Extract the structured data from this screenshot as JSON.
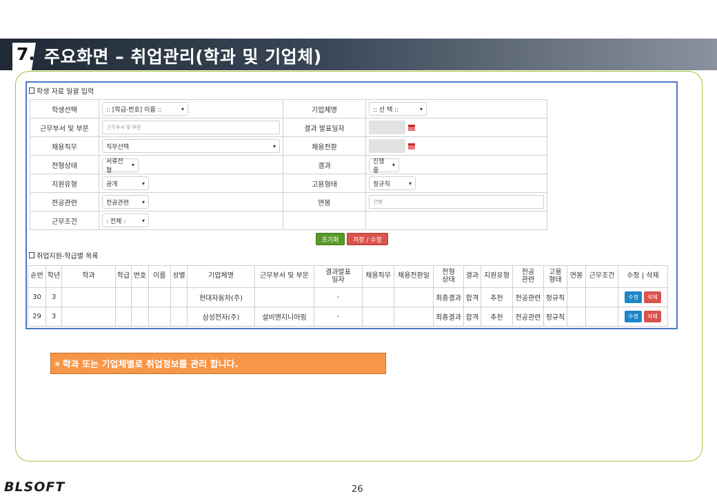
{
  "slide": {
    "number": "7.",
    "title": "주요화면 – 취업관리(학과 및 기업체)",
    "note": "학과 또는 기업체별로 취업정보를 관리 합니다.",
    "note_bullet": "■",
    "page": "26",
    "logo": "BLSOFT"
  },
  "form": {
    "section_title": "학생 자료 일괄 입력",
    "rows": [
      {
        "left_label": "학생선택",
        "left_value": ":: [학급-번호] 이름 ::",
        "right_label": "기업체명",
        "right_value": ":: 선 택 ::"
      },
      {
        "left_label": "근무부서 및 부문",
        "left_placeholder": "근무부서 및 부문",
        "right_label": "결과 발표일자"
      },
      {
        "left_label": "채용직무",
        "left_value": "직무선택",
        "right_label": "채용전환"
      },
      {
        "left_label": "전형상태",
        "left_value": "서류전형",
        "right_label": "결과",
        "right_value": "진행중"
      },
      {
        "left_label": "지원유형",
        "left_value": "공개",
        "right_label": "고용형태",
        "right_value": "정규직"
      },
      {
        "left_label": "전공관련",
        "left_value": "전공관련",
        "right_label": "연봉",
        "right_placeholder": "연봉"
      },
      {
        "left_label": "근무조건",
        "left_value": ": 전체 :"
      }
    ],
    "buttons": {
      "reset": "초기화",
      "save": "저장 / 수정"
    }
  },
  "list": {
    "section_title": "취업지원-학급별 목록",
    "headers": [
      "순번",
      "학년",
      "학과",
      "학급",
      "번호",
      "이름",
      "성별",
      "기업체명",
      "근무부서 및 부문",
      "결과발표\n일자",
      "채용직무",
      "채용전환일",
      "전형\n상태",
      "결과",
      "지원유형",
      "전공\n관련",
      "고용\n형태",
      "연봉",
      "근무조건",
      "수정 | 삭제"
    ],
    "rows": [
      {
        "no": "30",
        "grade": "3",
        "company": "현대자동차(주)",
        "dept": "",
        "date": "-",
        "status": "최종결과",
        "result": "합격",
        "apply": "추천",
        "major": "전공관련",
        "emp": "정규직"
      },
      {
        "no": "29",
        "grade": "3",
        "company": "삼성전자(주)",
        "dept": "설비엔지니어링",
        "date": "-",
        "status": "최종결과",
        "result": "합격",
        "apply": "추천",
        "major": "전공관련",
        "emp": "정규직"
      }
    ],
    "edit_label": "수정",
    "delete_label": "삭제"
  }
}
